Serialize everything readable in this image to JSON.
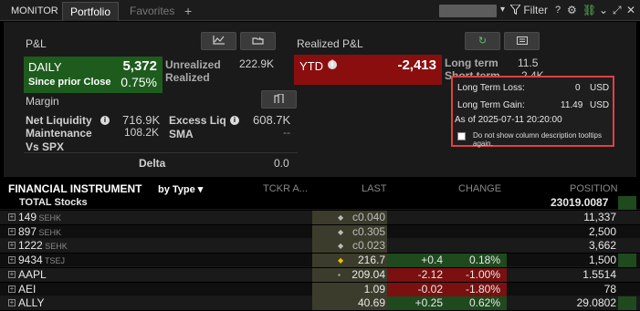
{
  "tabs": {
    "monitor": "MONITOR",
    "portfolio": "Portfolio",
    "favorites": "Favorites",
    "add": "+"
  },
  "toolbar": {
    "filter": "Filter",
    "help": "?",
    "dropdown": "▾"
  },
  "pnl": {
    "title": "P&L",
    "daily_label": "DAILY",
    "daily_value": "5,372",
    "since_label": "Since prior Close",
    "since_value": "0.75%",
    "unrealized_label": "Unrealized",
    "unrealized_value": "222.9K",
    "realized_label": "Realized"
  },
  "realized_pnl": {
    "title": "Realized P&L",
    "ytd_label": "YTD",
    "ytd_value": "-2,413",
    "long_term_label": "Long term",
    "long_term_value": "11.5",
    "short_term_label": "Short term",
    "short_term_value": "-2.4K"
  },
  "margin": {
    "title": "Margin",
    "net_liq_label": "Net Liquidity",
    "net_liq_value": "716.9K",
    "excess_liq_label": "Excess Liq",
    "excess_liq_value": "608.7K",
    "maintenance_label": "Maintenance",
    "maintenance_value": "108.2K",
    "sma_label": "SMA",
    "sma_value": "--",
    "vs_spx_label": "Vs SPX",
    "delta_label": "Delta",
    "delta_value": "0.0"
  },
  "tooltip": {
    "ltl_label": "Long Term Loss:",
    "ltl_value": "0",
    "ltl_ccy": "USD",
    "ltg_label": "Long Term Gain:",
    "ltg_value": "11.49",
    "ltg_ccy": "USD",
    "asof": "As of 2025-07-11 20:20:00",
    "checkbox_text": "Do not show column description tooltips again."
  },
  "table": {
    "headers": {
      "instrument": "FINANCIAL INSTRUMENT",
      "by_type": "by Type ▾",
      "tckr": "TCKR A...",
      "last": "LAST",
      "change": "CHANGE",
      "position": "POSITION"
    },
    "total": {
      "label": "TOTAL Stocks",
      "position": "23019.0087"
    },
    "rows": [
      {
        "symbol": "149",
        "exch": "SEHK",
        "marker": "◆",
        "last": "c0.040",
        "chg": "",
        "pct": "",
        "position": "11,337"
      },
      {
        "symbol": "897",
        "exch": "SEHK",
        "marker": "◆",
        "last": "c0.305",
        "chg": "",
        "pct": "",
        "position": "2,500"
      },
      {
        "symbol": "1222",
        "exch": "SEHK",
        "marker": "◆",
        "last": "c0.023",
        "chg": "",
        "pct": "",
        "position": "3,662"
      },
      {
        "symbol": "9434",
        "exch": "TSEJ",
        "marker": "◆",
        "last": "216.7",
        "chg": "+0.4",
        "pct": "0.18%",
        "position": "1,500"
      },
      {
        "symbol": "AAPL",
        "exch": "",
        "marker": "▪",
        "last": "209.04",
        "chg": "-2.12",
        "pct": "-1.00%",
        "position": "1.5514"
      },
      {
        "symbol": "AEI",
        "exch": "",
        "marker": "",
        "last": "1.09",
        "chg": "-0.02",
        "pct": "-1.80%",
        "position": "78"
      },
      {
        "symbol": "ALLY",
        "exch": "",
        "marker": "",
        "last": "40.69",
        "chg": "+0.25",
        "pct": "0.62%",
        "position": "29.0802"
      }
    ]
  },
  "colors": {
    "green": "#1e5c1e",
    "red": "#8b0e0e",
    "down_cell": "#7a1010",
    "up_cell": "#1e4a1e"
  }
}
